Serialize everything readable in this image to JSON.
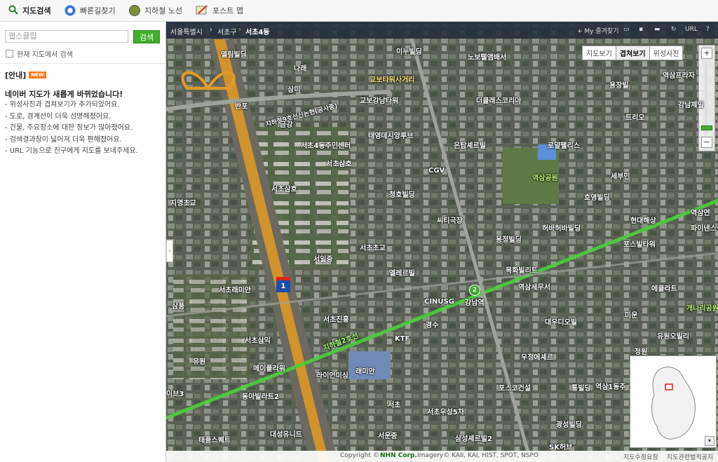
{
  "top_nav": {
    "tabs": [
      {
        "label": "지도검색",
        "icon": "magnifier-icon"
      },
      {
        "label": "빠른길찾기",
        "icon": "route-icon"
      },
      {
        "label": "지하철 노선",
        "icon": "subway-icon"
      },
      {
        "label": "포스트 맵",
        "icon": "post-map-icon"
      }
    ],
    "active": "지도검색"
  },
  "search": {
    "placeholder": "웹스클립",
    "button_label": "검색",
    "checkbox_label": "현재 지도에서 검색"
  },
  "notice": {
    "header": "[안내]",
    "badge": "NEW",
    "title": "네이버 지도가 새롭게 바뀌었습니다!",
    "items": [
      "- 위성사진과 겹쳐보기가 추가되었어요.",
      "- 도로, 경계선이 더욱 선명해졌어요.",
      "- 건물, 주요장소에 대한 정보가 많아졌어요.",
      "- 검색결과창이 넓어져 더욱 편해졌어요.",
      "- URL 기능으로 친구에게 지도를 보내주세요."
    ]
  },
  "map": {
    "breadcrumb": [
      "서울특별시",
      "서초구",
      "서초4동"
    ],
    "tools": [
      "+ My 즐겨찾기",
      "URL",
      "?"
    ],
    "view_tabs": [
      {
        "label": "지도보기",
        "active": false
      },
      {
        "label": "겹쳐보기",
        "active": true
      },
      {
        "label": "위성사진",
        "active": false
      }
    ],
    "zoom_in": "+",
    "zoom_out": "−",
    "pois": [
      "엘림빌딩",
      "이누빌딩",
      "노보텔앰배서",
      "역삼프라자",
      "나래",
      "교보타워사거리",
      "삼미",
      "교보강남타워",
      "더클래스코리아",
      "용장빌",
      "강남제일",
      "반포",
      "지하철9호선신논현(공사중)",
      "트리오",
      "금강",
      "태영데시앙루브",
      "서초4동주민센터",
      "은탑셰르빌",
      "로얄팰리스",
      "서초삼호",
      "CGV",
      "역삼공원",
      "서초삼호",
      "청호빌딩",
      "세부민",
      "지명초교",
      "호영빌딩",
      "역삼연",
      "씨티극장",
      "현대해상",
      "파이낸스",
      "허바허바빌딩",
      "서초초교",
      "용정빌딩",
      "포스빌타워",
      "서일중",
      "엘레르빌",
      "목화빌리트",
      "서초래미안",
      "역삼세무서",
      "에클라트",
      "삼풍",
      "CINUSG",
      "강남역",
      "미운",
      "대우디오빌",
      "개나리공원",
      "서초진흥",
      "경수",
      "KTF",
      "유원오빌리",
      "서초삼익",
      "지하철2호선",
      "정원",
      "유원",
      "메이플라워",
      "우정에셰르",
      "라이언미싱",
      "래미안",
      "포스코건설",
      "통빌딩",
      "역삼1동주",
      "이브3",
      "동아빌라트2",
      "서초",
      "서초우성5차",
      "광성빌딩",
      "태풍스퀘트",
      "대성유니드",
      "서운중",
      "삼성셰르빌2",
      "SK허브"
    ],
    "road_shield": "1",
    "subway_line_badge": "2",
    "footer": {
      "copyright_prefix": "Copyright ©",
      "company": "NHN Corp.",
      "imagery": "Imagery© KAII, KAI, HIST, SPOT, NSPO",
      "links": [
        "지도수정요청",
        "지도관련법적공지"
      ]
    }
  },
  "colors": {
    "accent_green": "#3fae2a",
    "new_badge": "#ff7a1a",
    "subway_line2": "#4bd13a",
    "highway": "#e39a22"
  }
}
